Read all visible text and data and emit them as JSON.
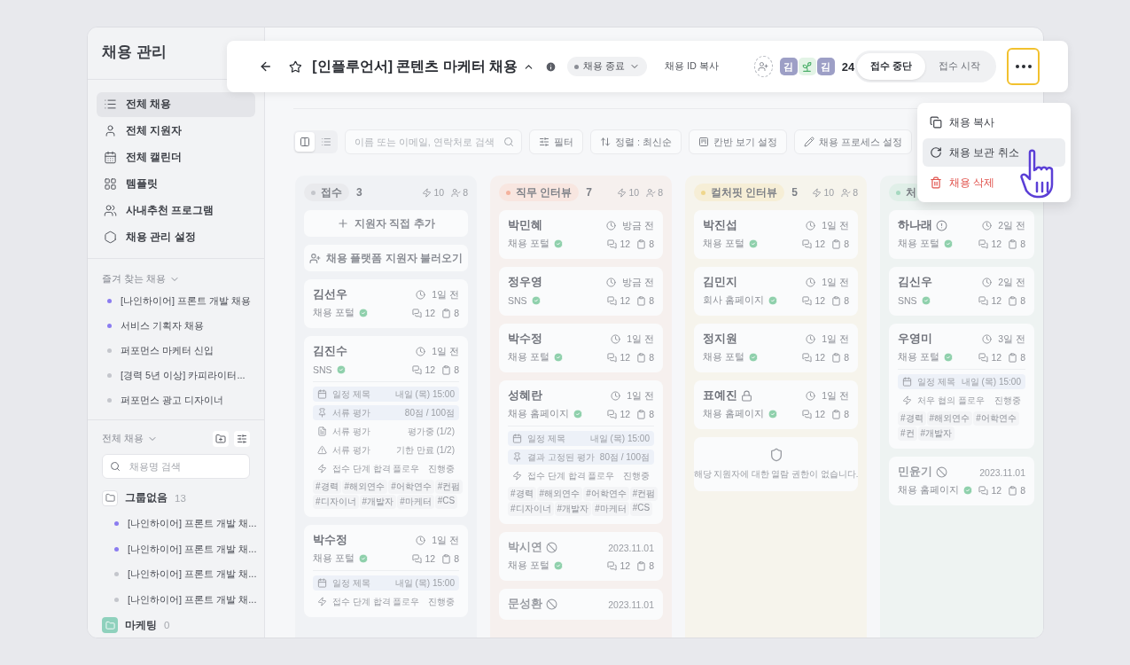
{
  "sidebar": {
    "title": "채용 관리",
    "nav": [
      {
        "label": "전체 채용",
        "selected": true
      },
      {
        "label": "전체 지원자",
        "selected": false
      },
      {
        "label": "전체 캘린더",
        "selected": false
      },
      {
        "label": "템플릿",
        "selected": false
      },
      {
        "label": "사내추천 프로그램",
        "selected": false
      },
      {
        "label": "채용 관리 설정",
        "selected": false
      }
    ],
    "favorites_title": "즐겨 찾는 채용",
    "favorites": [
      {
        "label": "[나인하이어] 프론트 개발 채용",
        "color": "#8b7cf0"
      },
      {
        "label": "서비스 기획자 채용",
        "color": "#8b7cf0"
      },
      {
        "label": "퍼포먼스 마케터 신입",
        "color": "#c4c6cc"
      },
      {
        "label": "[경력 5년 이상] 카피라이터...",
        "color": "#c4c6cc"
      },
      {
        "label": "퍼포먼스 광고 디자이너",
        "color": "#c4c6cc"
      }
    ],
    "all_title": "전체 채용",
    "search_placeholder": "채용명 검색",
    "groups": [
      {
        "name": "그룹없음",
        "count": "13",
        "kind": "plain",
        "children": [
          {
            "label": "[나인하이어] 프론트 개발 채...",
            "color": "#8b7cf0"
          },
          {
            "label": "[나인하이어] 프론트 개발 채...",
            "color": "#8b7cf0"
          },
          {
            "label": "[나인하이어] 프론트 개발 채...",
            "color": "#c4c6cc"
          },
          {
            "label": "[나인하이어] 프론트 개발 채...",
            "color": "#c4c6cc"
          }
        ]
      },
      {
        "name": "마케팅",
        "count": "0",
        "kind": "teal"
      }
    ]
  },
  "header": {
    "title": "[인플루언서] 콘텐츠 마케터 채용",
    "status": "채용 종료",
    "copy_id": "채용 ID 복사",
    "avatars": [
      {
        "kind": "initial",
        "text": "김"
      },
      {
        "kind": "sprout"
      },
      {
        "kind": "initial",
        "text": "김"
      }
    ],
    "member_count": "24",
    "toggle": [
      {
        "label": "접수 중단",
        "selected": true
      },
      {
        "label": "접수 시작",
        "selected": false
      }
    ],
    "more_highlighted": true
  },
  "menu": [
    {
      "label": "채용 복사",
      "kind": "copy",
      "selected": false
    },
    {
      "label": "채용 보관 취소",
      "kind": "restore",
      "selected": true
    },
    {
      "label": "채용 삭제",
      "kind": "delete",
      "selected": false
    }
  ],
  "toolbar": {
    "views": [
      {
        "kind": "kanban",
        "selected": true
      },
      {
        "kind": "list",
        "selected": false
      }
    ],
    "search_placeholder": "이름 또는 이메일, 연락처로 검색",
    "buttons": [
      {
        "label": "필터",
        "kind": "filter"
      },
      {
        "label": "정렬 : 최신순",
        "kind": "sort"
      },
      {
        "label": "칸반 보기 설정",
        "kind": "kanban"
      },
      {
        "label": "채용 프로세스 설정",
        "kind": "process"
      }
    ]
  },
  "columns": [
    {
      "name": "접수",
      "color": "#c4c6cb",
      "count": "3",
      "flows": "10",
      "people": "8",
      "actions": [
        {
          "label": "지원자 직접 추가",
          "kind": "add"
        },
        {
          "label": "채용 플랫폼 지원자 불러오기",
          "kind": "import"
        }
      ],
      "cards": [
        {
          "kind": "applicant",
          "dropped": false,
          "locked": false,
          "alert": false,
          "name": "김선우",
          "time": "1일 전",
          "source": "채용 포털",
          "verified": true,
          "comments": "12",
          "docs": "8"
        },
        {
          "kind": "applicant",
          "dropped": false,
          "locked": false,
          "alert": false,
          "name": "김진수",
          "time": "1일 전",
          "source": "SNS",
          "verified": true,
          "comments": "12",
          "docs": "8",
          "details": [
            {
              "kind": "schedule",
              "label": "일정 제목",
              "value": "내일 (목) 15:00"
            },
            {
              "kind": "pinned",
              "label": "서류 평가",
              "value": "80점 / 100점"
            },
            {
              "kind": "doc",
              "label": "서류 평가",
              "value": "평가중 (1/2)"
            },
            {
              "kind": "warning",
              "label": "서류 평가",
              "value": "기한 만료 (1/2)"
            },
            {
              "kind": "flow",
              "label": "접수 단계 합격 플로우",
              "value": "진행중"
            }
          ],
          "tags": [
            "#경력",
            "#해외연수",
            "#어학연수",
            "#컨펌",
            "#디자이너",
            "#개발자",
            "#마케터",
            "#CS"
          ]
        },
        {
          "kind": "applicant",
          "dropped": false,
          "locked": false,
          "alert": false,
          "name": "박수정",
          "time": "1일 전",
          "source": "채용 포털",
          "verified": true,
          "comments": "12",
          "docs": "8",
          "details": [
            {
              "kind": "schedule",
              "label": "일정 제목",
              "value": "내일 (목) 15:00"
            },
            {
              "kind": "flow",
              "label": "접수 단계 합격 플로우",
              "value": "진행중"
            }
          ]
        }
      ]
    },
    {
      "name": "직무 인터뷰",
      "color": "#f4b29d",
      "count": "7",
      "flows": "10",
      "people": "8",
      "cards": [
        {
          "kind": "applicant",
          "dropped": false,
          "locked": false,
          "alert": false,
          "name": "박민혜",
          "time": "방금 전",
          "source": "채용 포털",
          "verified": true,
          "comments": "12",
          "docs": "8"
        },
        {
          "kind": "applicant",
          "dropped": false,
          "locked": false,
          "alert": false,
          "name": "정우영",
          "time": "방금 전",
          "source": "SNS",
          "verified": true,
          "comments": "12",
          "docs": "8"
        },
        {
          "kind": "applicant",
          "dropped": false,
          "locked": false,
          "alert": false,
          "name": "박수정",
          "time": "1일 전",
          "source": "채용 포털",
          "verified": true,
          "comments": "12",
          "docs": "8"
        },
        {
          "kind": "applicant",
          "dropped": false,
          "locked": false,
          "alert": false,
          "name": "성혜란",
          "time": "1일 전",
          "source": "채용 홈페이지",
          "verified": true,
          "comments": "12",
          "docs": "8",
          "details": [
            {
              "kind": "schedule",
              "label": "일정 제목",
              "value": "내일 (목) 15:00"
            },
            {
              "kind": "pinned",
              "label": "결과 고정된 평가",
              "value": "80점 / 100점"
            },
            {
              "kind": "flow",
              "label": "접수 단계 합격 플로우",
              "value": "진행중"
            }
          ],
          "tags": [
            "#경력",
            "#해외연수",
            "#어학연수",
            "#컨펌",
            "#디자이너",
            "#개발자",
            "#마케터",
            "#CS"
          ]
        },
        {
          "kind": "applicant",
          "dropped": true,
          "locked": false,
          "alert": false,
          "name": "박시연",
          "time": "2023.11.01",
          "source": "채용 포털",
          "verified": true,
          "comments": "12",
          "docs": "8"
        },
        {
          "kind": "applicant",
          "dropped": true,
          "locked": false,
          "alert": false,
          "name": "문성환",
          "time": "2023.11.01"
        }
      ]
    },
    {
      "name": "컬처핏 인터뷰",
      "color": "#efd68c",
      "count": "5",
      "flows": "10",
      "people": "8",
      "cards": [
        {
          "kind": "applicant",
          "dropped": false,
          "locked": false,
          "alert": false,
          "name": "박진섭",
          "time": "1일 전",
          "source": "채용 포털",
          "verified": true,
          "comments": "12",
          "docs": "8"
        },
        {
          "kind": "applicant",
          "dropped": false,
          "locked": false,
          "alert": false,
          "name": "김민지",
          "time": "1일 전",
          "source": "회사 홈페이지",
          "verified": true,
          "comments": "12",
          "docs": "8"
        },
        {
          "kind": "applicant",
          "dropped": false,
          "locked": false,
          "alert": false,
          "name": "정지원",
          "time": "1일 전",
          "source": "채용 포털",
          "verified": true,
          "comments": "12",
          "docs": "8"
        },
        {
          "kind": "applicant",
          "dropped": false,
          "locked": true,
          "alert": false,
          "name": "표예진",
          "time": "1일 전",
          "source": "채용 홈페이지",
          "verified": true,
          "comments": "12",
          "docs": "8"
        },
        {
          "kind": "no_access",
          "message": "해당 지원자에 대한 열람 권한이 없습니다."
        }
      ]
    },
    {
      "name": "처",
      "color": "#a6d8c0",
      "cards": [
        {
          "kind": "applicant",
          "dropped": false,
          "locked": false,
          "alert": true,
          "name": "하나래",
          "time": "2일 전",
          "source": "채용 포털",
          "verified": true,
          "comments": "12",
          "docs": "8"
        },
        {
          "kind": "applicant",
          "dropped": false,
          "locked": false,
          "alert": false,
          "name": "김신우",
          "time": "2일 전",
          "source": "SNS",
          "verified": true,
          "comments": "12",
          "docs": "8"
        },
        {
          "kind": "applicant",
          "dropped": false,
          "locked": false,
          "alert": false,
          "name": "우영미",
          "time": "3일 전",
          "source": "채용 포털",
          "verified": true,
          "comments": "12",
          "docs": "8",
          "details": [
            {
              "kind": "schedule",
              "label": "일정 제목",
              "value": "내일 (목) 15:00"
            },
            {
              "kind": "flow",
              "label": "처우 협의 플로우",
              "value": "진행중"
            }
          ],
          "tags": [
            "#경력",
            "#해외연수",
            "#어학연수",
            "#컨",
            "#개발자"
          ]
        },
        {
          "kind": "applicant",
          "dropped": true,
          "locked": false,
          "alert": false,
          "name": "민윤기",
          "time": "2023.11.01",
          "source": "채용 홈페이지",
          "verified": true,
          "comments": "12",
          "docs": "8"
        }
      ]
    }
  ]
}
